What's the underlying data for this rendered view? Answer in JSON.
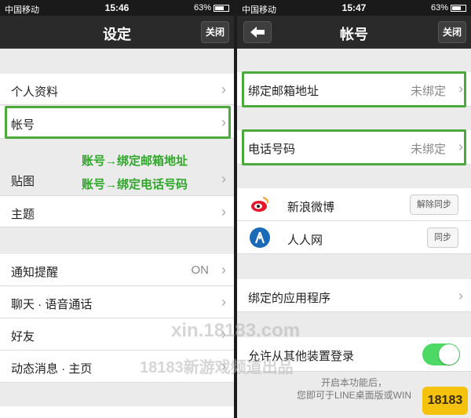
{
  "left": {
    "status": {
      "carrier": "中国移动",
      "time": "15:46",
      "battery": "63%"
    },
    "nav": {
      "title": "设定",
      "close": "关闭"
    },
    "items": {
      "profile": "个人资料",
      "account": "帐号",
      "stickers": "贴图",
      "themes": "主题",
      "notify": "通知提醒",
      "notify_value": "ON",
      "chat": "聊天 · 语音通话",
      "friends": "好友",
      "timeline": "动态消息 · 主页"
    }
  },
  "right": {
    "status": {
      "carrier": "中国移动",
      "time": "15:47",
      "battery": "63%"
    },
    "nav": {
      "title": "帐号",
      "close": "关闭"
    },
    "email": {
      "label": "绑定邮箱地址",
      "value": "未绑定"
    },
    "phone": {
      "label": "电话号码",
      "value": "未绑定"
    },
    "weibo": {
      "label": "新浪微博",
      "button": "解除同步"
    },
    "renren": {
      "label": "人人网",
      "button": "同步"
    },
    "apps": "绑定的应用程序",
    "allow": {
      "label": "允许从其他装置登录",
      "on": true
    },
    "footnote1": "开启本功能后，",
    "footnote2": "您即可于LINE桌面版或WIN"
  },
  "annotations": {
    "line1": "账号→绑定邮箱地址",
    "line2": "账号→绑定电话号码"
  },
  "watermark": {
    "line1": "xin.18183.com",
    "line2": "18183新游戏频道出品",
    "logo": "18183"
  },
  "colors": {
    "highlight": "#4caa3b",
    "toggle_on": "#4cd964",
    "annotation": "#2fa82a"
  }
}
